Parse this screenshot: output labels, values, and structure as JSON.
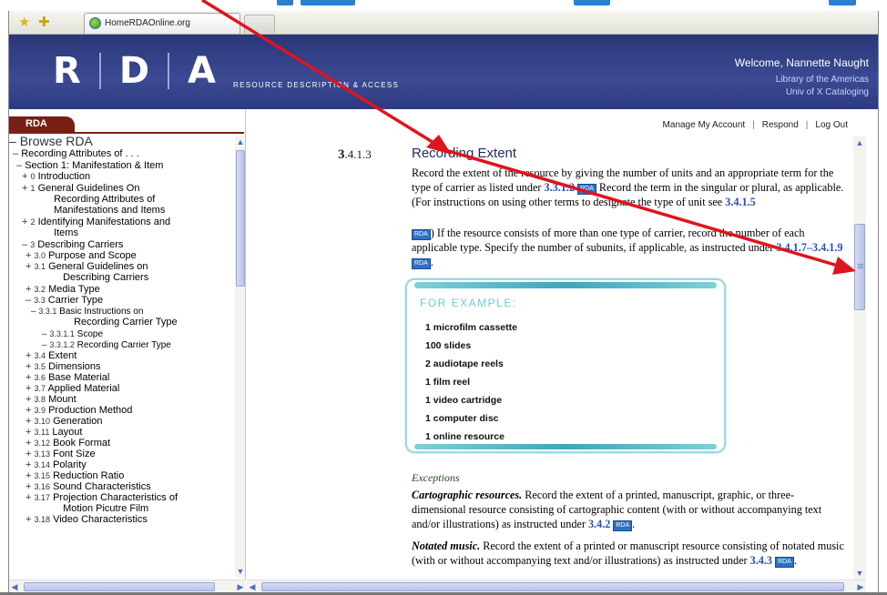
{
  "browser": {
    "tab_title": "HomeRDAOnline.org"
  },
  "banner": {
    "logo_letters": [
      "R",
      "D",
      "A"
    ],
    "tagline": "RESOURCE DESCRIPTION & ACCESS",
    "welcome": "Welcome, Nannette Naught",
    "org_line1": "Library of the Americas",
    "org_line2": "Univ of X Cataloging"
  },
  "sidebar": {
    "tab_label": "RDA",
    "root": "Browse RDA",
    "items": [
      {
        "pm": "–",
        "num": "",
        "label": "Recording Attributes of . . ."
      },
      {
        "pm": "–",
        "num": "",
        "label": "Section 1: Manifestation & Item"
      },
      {
        "pm": "+",
        "num": "0",
        "label": "Introduction"
      },
      {
        "pm": "+",
        "num": "1",
        "label": "General Guidelines On"
      },
      {
        "pm": "",
        "num": "",
        "label": "Recording Attributes of"
      },
      {
        "pm": "",
        "num": "",
        "label": "Manifestations and Items"
      },
      {
        "pm": "+",
        "num": "2",
        "label": "Identifying Manifestations and"
      },
      {
        "pm": "",
        "num": "",
        "label": "Items"
      },
      {
        "pm": "–",
        "num": "3",
        "label": "Describing Carriers"
      },
      {
        "pm": "+",
        "num": "3.0",
        "label": "Purpose and Scope"
      },
      {
        "pm": "+",
        "num": "3.1",
        "label": "General Guidelines on"
      },
      {
        "pm": "",
        "num": "",
        "label": "Describing Carriers"
      },
      {
        "pm": "+",
        "num": "3.2",
        "label": "Media Type"
      },
      {
        "pm": "–",
        "num": "3.3",
        "label": "Carrier Type"
      },
      {
        "pm": "–",
        "num": "3.3.1",
        "label": "Basic Instructions on"
      },
      {
        "pm": "",
        "num": "",
        "label": "Recording Carrier Type"
      },
      {
        "pm": "–",
        "num": "3.3.1.1",
        "label": "Scope"
      },
      {
        "pm": "–",
        "num": "3.3.1.2",
        "label": "Recording Carrier Type"
      },
      {
        "pm": "+",
        "num": "3.4",
        "label": "Extent"
      },
      {
        "pm": "+",
        "num": "3.5",
        "label": "Dimensions"
      },
      {
        "pm": "+",
        "num": "3.6",
        "label": "Base Material"
      },
      {
        "pm": "+",
        "num": "3.7",
        "label": "Applied Material"
      },
      {
        "pm": "+",
        "num": "3.8",
        "label": "Mount"
      },
      {
        "pm": "+",
        "num": "3.9",
        "label": "Production Method"
      },
      {
        "pm": "+",
        "num": "3.10",
        "label": "Generation"
      },
      {
        "pm": "+",
        "num": "3.11",
        "label": "Layout"
      },
      {
        "pm": "+",
        "num": "3.12",
        "label": "Book Format"
      },
      {
        "pm": "+",
        "num": "3.13",
        "label": "Font Size"
      },
      {
        "pm": "+",
        "num": "3.14",
        "label": "Polarity"
      },
      {
        "pm": "+",
        "num": "3.15",
        "label": "Reduction Ratio"
      },
      {
        "pm": "+",
        "num": "3.16",
        "label": "Sound Characteristics"
      },
      {
        "pm": "+",
        "num": "3.17",
        "label": "Projection Characteristics of"
      },
      {
        "pm": "",
        "num": "",
        "label": "Motion Picutre Film"
      },
      {
        "pm": "+",
        "num": "3.18",
        "label": "Video Characteristics"
      }
    ]
  },
  "nav": {
    "account": "Manage My Account",
    "respond": "Respond",
    "logout": "Log Out",
    "sep": "|"
  },
  "section": {
    "number_bold": "3",
    "number_rest": ".4.1.3",
    "title": "Recording Extent",
    "p1_a": "Record the extent of the resource by giving the number of units and an appropriate term for the type of carrier as listed under ",
    "p1_link1": "3.3.1.2",
    "p1_b": " Record the term in the singular or plural, as applicable. (For instructions on using other terms to designate the type of unit see ",
    "p1_link2": "3.4.1.5",
    "p2_a": ") If the resource consists of more than one type of carrier, record the number of each applicable type. Specify the number of subunits, if applicable, as instructed under ",
    "p2_link": "3.4.1.7–3.4.1.9",
    "rda_icon": "RDA"
  },
  "example": {
    "heading": "FOR EXAMPLE:",
    "items": [
      "1 microfilm cassette",
      "100 slides",
      "2 audiotape reels",
      "1 film reel",
      "1 video cartridge",
      "1 computer disc",
      "1 online resource"
    ]
  },
  "exceptions": {
    "heading": "Exceptions",
    "c_label": "Cartographic resources.",
    "c_text": " Record the extent of a printed, manuscript, graphic, or three-dimensional resource consisting of cartographic content (with or without accompanying text and/or illustrations) as instructed under ",
    "c_link": "3.4.2",
    "n_label": "Notated music.",
    "n_text": " Record the extent of a printed or manuscript resource consisting of notated music (with or without accompanying text and/or illustrations) as instructed under ",
    "n_link": "3.4.3"
  },
  "colors": {
    "banner": "#2a3779",
    "rda_tab": "#7a1f14",
    "link": "#2a4fb0",
    "arrow": "#e0141c",
    "example_accent": "#6ccbd4"
  }
}
